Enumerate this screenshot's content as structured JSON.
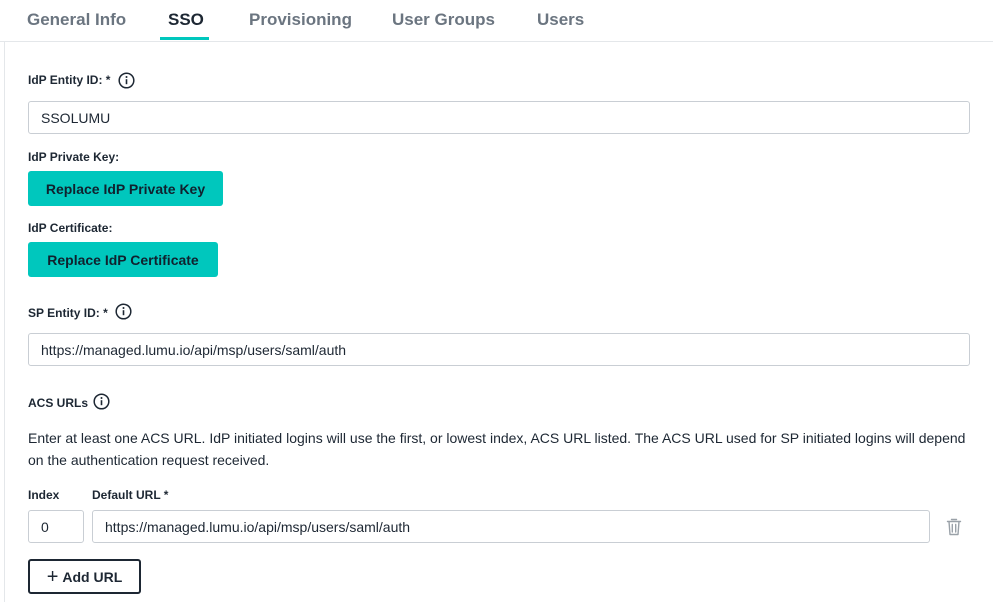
{
  "tabs": [
    {
      "label": "General Info",
      "active": false
    },
    {
      "label": "SSO",
      "active": true
    },
    {
      "label": "Provisioning",
      "active": false
    },
    {
      "label": "User Groups",
      "active": false
    },
    {
      "label": "Users",
      "active": false
    }
  ],
  "idp_entity": {
    "label": "IdP Entity ID: *",
    "value": "SSOLUMU"
  },
  "idp_private_key": {
    "label": "IdP Private Key:",
    "button": "Replace IdP Private Key"
  },
  "idp_certificate": {
    "label": "IdP Certificate:",
    "button": "Replace IdP Certificate"
  },
  "sp_entity": {
    "label": "SP Entity ID: *",
    "value": "https://managed.lumu.io/api/msp/users/saml/auth"
  },
  "acs": {
    "label": "ACS URLs",
    "help": "Enter at least one ACS URL. IdP initiated logins will use the first, or lowest index, ACS URL listed. The ACS URL used for SP initiated logins will depend on the authentication request received.",
    "index_header": "Index",
    "url_header": "Default URL *",
    "rows": [
      {
        "index": "0",
        "url": "https://managed.lumu.io/api/msp/users/saml/auth"
      }
    ],
    "add_button": "Add URL"
  },
  "colors": {
    "accent": "#00c7bd",
    "text": "#1d2733",
    "muted": "#6b7580"
  }
}
